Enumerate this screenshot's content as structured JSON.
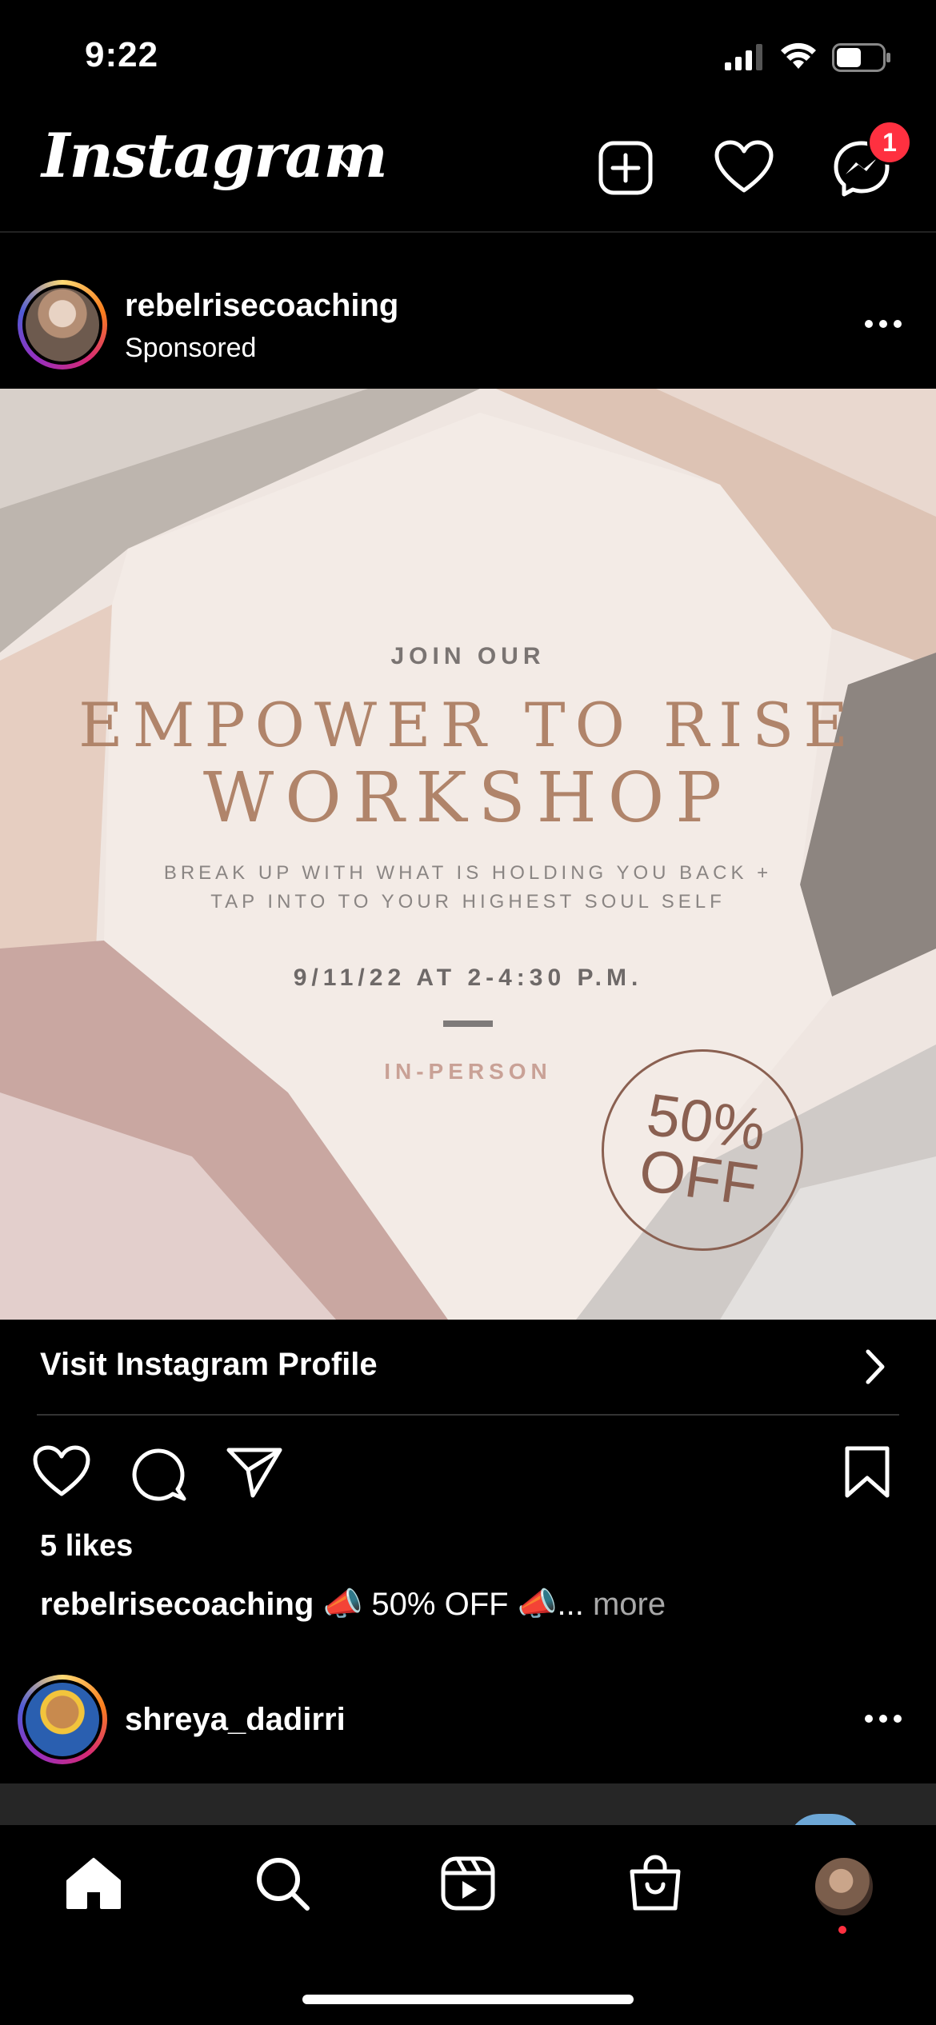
{
  "status_bar": {
    "time": "9:22"
  },
  "header": {
    "logo": "Instagram",
    "logo_icon": "chevron-down-icon",
    "actions": [
      "new-post-icon",
      "heart-icon",
      "messenger-icon"
    ],
    "messenger_badge": "1"
  },
  "post": {
    "username": "rebelrisecoaching",
    "label": "Sponsored",
    "menu_icon": "more-icon"
  },
  "ad": {
    "join": "JOIN OUR",
    "title_line1": "EMPOWER TO RISE",
    "title_line2": "WORKSHOP",
    "tagline_line1": "BREAK UP WITH WHAT IS HOLDING YOU BACK +",
    "tagline_line2": "TAP INTO TO YOUR HIGHEST SOUL SELF",
    "date": "9/11/22 AT 2-4:30 P.M.",
    "format": "IN-PERSON",
    "discount_line1": "50%",
    "discount_line2": "OFF"
  },
  "cta": {
    "label": "Visit Instagram Profile",
    "icon": "chevron-right-icon"
  },
  "actions": {
    "icons": [
      "like-icon",
      "comment-icon",
      "share-icon",
      "save-icon"
    ]
  },
  "likes": "5 likes",
  "caption": {
    "username": "rebelrisecoaching",
    "text": "📣 50% OFF 📣...",
    "more": "more"
  },
  "next_post": {
    "username": "shreya_dadirri"
  },
  "bottom_nav": {
    "items": [
      "home-icon",
      "search-icon",
      "reels-icon",
      "shop-icon",
      "profile-avatar"
    ]
  },
  "colors": {
    "background": "#000000",
    "badge": "#ff3040",
    "ad_title": "#b0846a",
    "muted": "#a8a8a8"
  }
}
